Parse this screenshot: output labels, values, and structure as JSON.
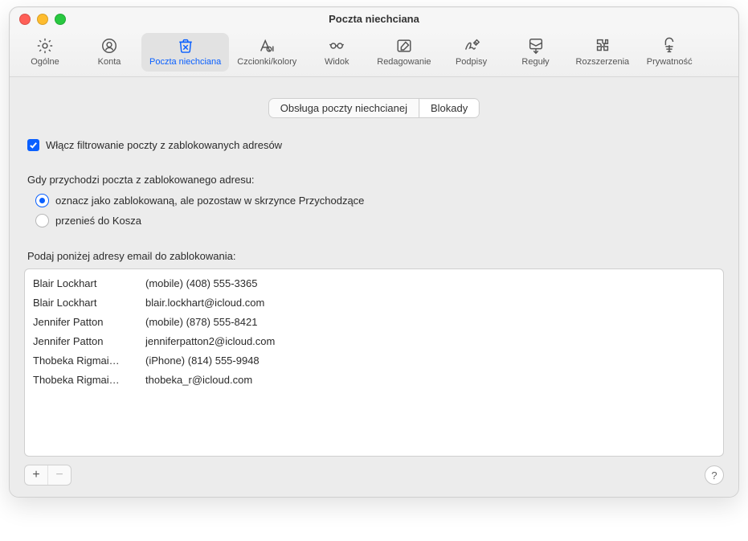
{
  "window": {
    "title": "Poczta niechciana"
  },
  "toolbar": {
    "items": [
      {
        "id": "general",
        "label": "Ogólne"
      },
      {
        "id": "accounts",
        "label": "Konta"
      },
      {
        "id": "junk",
        "label": "Poczta niechciana"
      },
      {
        "id": "fonts",
        "label": "Czcionki/kolory"
      },
      {
        "id": "viewing",
        "label": "Widok"
      },
      {
        "id": "composing",
        "label": "Redagowanie"
      },
      {
        "id": "signatures",
        "label": "Podpisy"
      },
      {
        "id": "rules",
        "label": "Reguły"
      },
      {
        "id": "extensions",
        "label": "Rozszerzenia"
      },
      {
        "id": "privacy",
        "label": "Prywatność"
      }
    ],
    "selected": "junk"
  },
  "subtabs": {
    "items": [
      {
        "id": "handling",
        "label": "Obsługa poczty niechcianej"
      },
      {
        "id": "blocked",
        "label": "Blokady"
      }
    ],
    "selected": "blocked"
  },
  "enable_filter": {
    "checked": true,
    "label": "Włącz filtrowanie poczty z zablokowanych adresów"
  },
  "radio_heading": "Gdy przychodzi poczta z zablokowanego adresu:",
  "radios": {
    "selected": "mark",
    "options": [
      {
        "id": "mark",
        "label": "oznacz jako zablokowaną, ale pozostaw w skrzynce Przychodzące"
      },
      {
        "id": "trash",
        "label": "przenieś do Kosza"
      }
    ]
  },
  "list_heading": "Podaj poniżej adresy email do zablokowania:",
  "blocked_list": [
    {
      "name": "Blair Lockhart",
      "address": "(mobile) (408) 555-3365"
    },
    {
      "name": "Blair Lockhart",
      "address": "blair.lockhart@icloud.com"
    },
    {
      "name": "Jennifer Patton",
      "address": "(mobile) (878) 555-8421"
    },
    {
      "name": "Jennifer Patton",
      "address": "jenniferpatton2@icloud.com"
    },
    {
      "name": "Thobeka Rigmai…",
      "address": "(iPhone) (814) 555-9948"
    },
    {
      "name": "Thobeka Rigmai…",
      "address": "thobeka_r@icloud.com"
    }
  ],
  "footer": {
    "add": "+",
    "remove": "−",
    "help": "?"
  }
}
